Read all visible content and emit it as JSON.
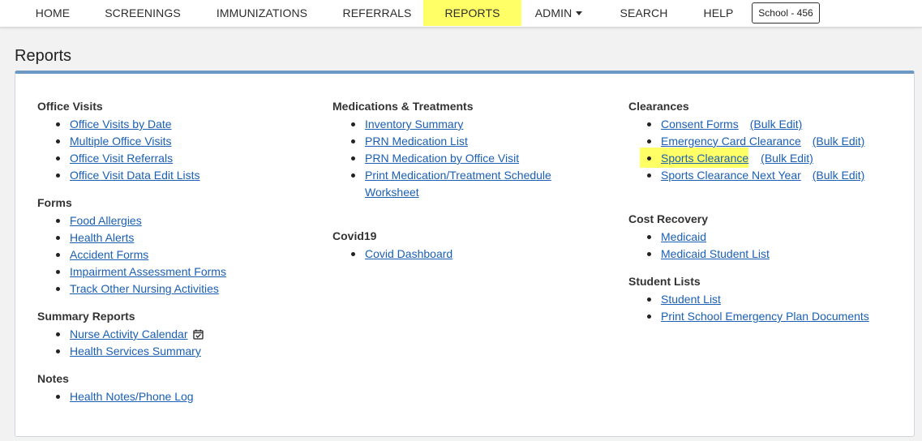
{
  "nav": {
    "home": "HOME",
    "screenings": "SCREENINGS",
    "immunizations": "IMMUNIZATIONS",
    "referrals": "REFERRALS",
    "reports": "REPORTS",
    "admin": "ADMIN",
    "search": "SEARCH",
    "help": "HELP",
    "school": "School - 456",
    "active": "REPORTS",
    "active_color": "#ffff66"
  },
  "page": {
    "title": "Reports"
  },
  "col1": {
    "office_visits": {
      "title": "Office Visits",
      "items": [
        "Office Visits by Date",
        "Multiple Office Visits",
        "Office Visit Referrals",
        "Office Visit Data Edit Lists"
      ]
    },
    "forms": {
      "title": "Forms",
      "items": [
        "Food Allergies",
        "Health Alerts",
        "Accident Forms",
        "Impairment Assessment Forms",
        "Track Other Nursing Activities"
      ]
    },
    "summary": {
      "title": "Summary Reports",
      "items": [
        "Nurse Activity Calendar",
        "Health Services Summary"
      ],
      "calendar_icon": "calendar-check-icon"
    },
    "notes": {
      "title": "Notes",
      "items": [
        "Health Notes/Phone Log"
      ]
    }
  },
  "col2": {
    "meds": {
      "title": "Medications & Treatments",
      "items": [
        "Inventory Summary",
        "PRN Medication List",
        "PRN Medication by Office Visit",
        "Print Medication/Treatment Schedule",
        "Worksheet"
      ]
    },
    "covid": {
      "title": "Covid19",
      "items": [
        "Covid Dashboard"
      ]
    }
  },
  "col3": {
    "clearances": {
      "title": "Clearances",
      "items": [
        "Consent Forms",
        "Emergency Card Clearance",
        "Sports Clearance",
        "Sports Clearance Next Year"
      ],
      "bulk": "(Bulk Edit)",
      "highlighted": "Sports Clearance"
    },
    "cost": {
      "title": "Cost Recovery",
      "items": [
        "Medicaid",
        "Medicaid Student List"
      ]
    },
    "students": {
      "title": "Student Lists",
      "items": [
        "Student List",
        "Print School Emergency Plan Documents"
      ]
    }
  },
  "colors": {
    "link": "#1a5fb4",
    "panel_accent": "#6e98c4",
    "highlight": "#ffff66"
  }
}
